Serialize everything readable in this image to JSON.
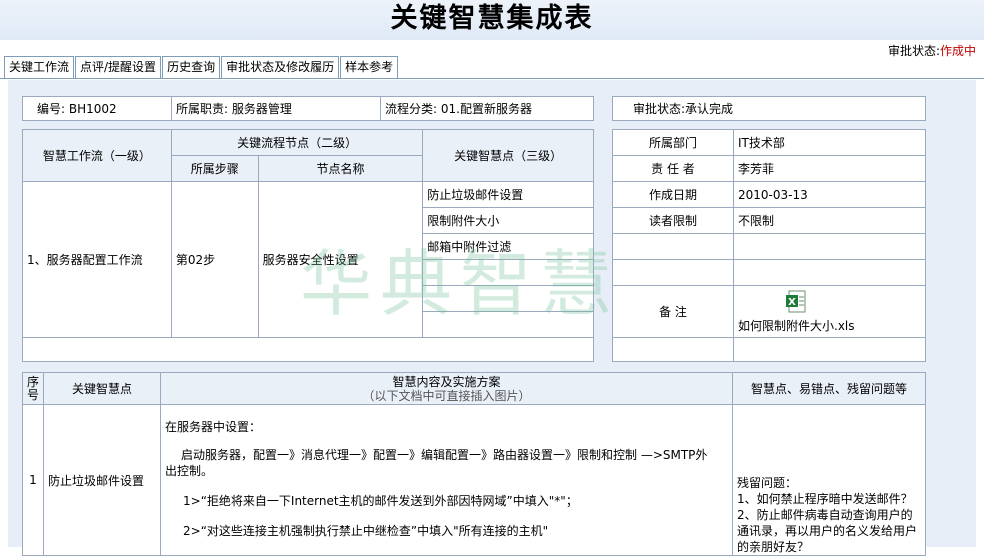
{
  "title": "关键智慧集成表",
  "approval_top": {
    "label": "审批状态:",
    "value": "作成中"
  },
  "tabs": [
    "关键工作流",
    "点评/提醒设置",
    "历史查询",
    "审批状态及修改履历",
    "样本参考"
  ],
  "info": {
    "number": "编号:  BH1002",
    "duty": "所属职责: 服务器管理",
    "process_class": "流程分类: 01.配置新服务器",
    "approval": "审批状态:承认完成"
  },
  "header": {
    "workflow_l1": "智慧工作流（一级）",
    "node_l2": "关键流程节点（二级）",
    "step": "所属步骤",
    "node_name": "节点名称",
    "point_l3": "关键智慧点（三级）"
  },
  "row": {
    "workflow": "1、服务器配置工作流",
    "step": "第02步",
    "node": "服务器安全性设置",
    "points": [
      "防止垃圾邮件设置",
      "限制附件大小",
      "邮箱中附件过滤"
    ]
  },
  "right": {
    "dept_label": "所属部门",
    "dept": "IT技术部",
    "owner_label": "责 任 者",
    "owner": "李芳菲",
    "date_label": "作成日期",
    "date": "2010-03-13",
    "reader_label": "读者限制",
    "reader": "不限制",
    "note_label": "备      注",
    "attachment": "如何限制附件大小.xls"
  },
  "watermark": "华典智慧",
  "bottom": {
    "col_no": "序号",
    "col_point": "关键智慧点",
    "col_content": "智慧内容及实施方案",
    "col_content_sub": "（以下文档中可直接插入图片）",
    "col_issues": "智慧点、易错点、残留问题等",
    "row_no": "1",
    "row_point": "防止垃圾邮件设置",
    "content": [
      "在服务器中设置：",
      "启动服务器，配置一》消息代理一》配置一》编辑配置一》路由器设置一》限制和控制 —>SMTP外出控制。",
      "1>“拒绝将来自一下Internet主机的邮件发送到外部因特网域”中填入\"*\"；",
      "2>“对这些连接主机强制执行禁止中继检查”中填入\"所有连接的主机\""
    ],
    "issues": [
      "残留问题：",
      "1、如何禁止程序暗中发送邮件？",
      "2、防止邮件病毒自动查询用户的通讯录，再以用户的名义发给用户的亲朋好友？"
    ]
  },
  "colors": {
    "panel": "#e8eef7",
    "status": "#c00000",
    "border": "#9aa9bd",
    "watermark": "#6ebe96"
  }
}
